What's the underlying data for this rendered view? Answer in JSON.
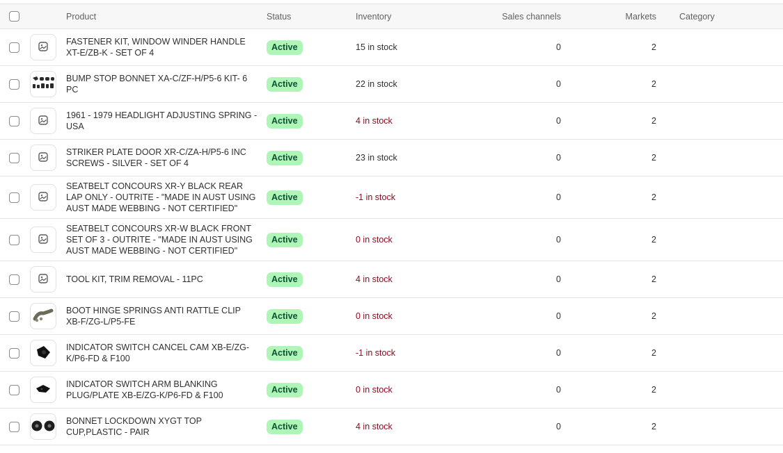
{
  "header": {
    "product": "Product",
    "status": "Status",
    "inventory": "Inventory",
    "sales_channels": "Sales channels",
    "markets": "Markets",
    "category": "Category"
  },
  "colors": {
    "active_badge_bg": "#aff5b8",
    "active_badge_text": "#0c5132",
    "low_stock_text": "#8e0b21"
  },
  "rows": [
    {
      "product": "FASTENER KIT, WINDOW WINDER HANDLE XT-E/ZB-K - SET OF 4",
      "status": "Active",
      "inventory": "15 in stock",
      "stock_level": "ok",
      "sales_channels": "0",
      "markets": "2",
      "category": "",
      "image": "image-placeholder-icon"
    },
    {
      "product": "BUMP STOP BONNET XA-C/ZF-H/P5-6 KIT- 6 PC",
      "status": "Active",
      "inventory": "22 in stock",
      "stock_level": "ok",
      "sales_channels": "0",
      "markets": "2",
      "category": "",
      "image": "bump-stops-photo"
    },
    {
      "product": "1961 - 1979 HEADLIGHT ADJUSTING SPRING - USA",
      "status": "Active",
      "inventory": "4 in stock",
      "stock_level": "low",
      "sales_channels": "0",
      "markets": "2",
      "category": "",
      "image": "image-placeholder-icon"
    },
    {
      "product": "STRIKER PLATE DOOR XR-C/ZA-H/P5-6 INC SCREWS - SILVER - SET OF 4",
      "status": "Active",
      "inventory": "23 in stock",
      "stock_level": "ok",
      "sales_channels": "0",
      "markets": "2",
      "category": "",
      "image": "image-placeholder-icon"
    },
    {
      "product": "SEATBELT CONCOURS XR-Y BLACK REAR LAP ONLY - OUTRITE - \"MADE IN AUST USING AUST MADE WEBBING - NOT CERTIFIED\"",
      "status": "Active",
      "inventory": "-1 in stock",
      "stock_level": "low",
      "sales_channels": "0",
      "markets": "2",
      "category": "",
      "image": "image-placeholder-icon"
    },
    {
      "product": "SEATBELT CONCOURS XR-W BLACK FRONT SET OF 3 - OUTRITE - \"MADE IN AUST USING AUST MADE WEBBING - NOT CERTIFIED\"",
      "status": "Active",
      "inventory": "0 in stock",
      "stock_level": "low",
      "sales_channels": "0",
      "markets": "2",
      "category": "",
      "image": "image-placeholder-icon"
    },
    {
      "product": "TOOL KIT, TRIM REMOVAL - 11PC",
      "status": "Active",
      "inventory": "4 in stock",
      "stock_level": "low",
      "sales_channels": "0",
      "markets": "2",
      "category": "",
      "image": "image-placeholder-icon"
    },
    {
      "product": "BOOT HINGE SPRINGS ANTI RATTLE CLIP XB-F/ZG-L/P5-FE",
      "status": "Active",
      "inventory": "0 in stock",
      "stock_level": "low",
      "sales_channels": "0",
      "markets": "2",
      "category": "",
      "image": "hinge-clip-photo"
    },
    {
      "product": "INDICATOR SWITCH CANCEL CAM XB-E/ZG-K/P6-FD & F100",
      "status": "Active",
      "inventory": "-1 in stock",
      "stock_level": "low",
      "sales_channels": "0",
      "markets": "2",
      "category": "",
      "image": "cancel-cam-photo"
    },
    {
      "product": "INDICATOR SWITCH ARM BLANKING PLUG/PLATE XB-E/ZG-K/P6-FD & F100",
      "status": "Active",
      "inventory": "0 in stock",
      "stock_level": "low",
      "sales_channels": "0",
      "markets": "2",
      "category": "",
      "image": "blanking-plug-photo"
    },
    {
      "product": "BONNET LOCKDOWN XYGT TOP CUP,PLASTIC - PAIR",
      "status": "Active",
      "inventory": "4 in stock",
      "stock_level": "low",
      "sales_channels": "0",
      "markets": "2",
      "category": "",
      "image": "top-cups-photo"
    }
  ]
}
